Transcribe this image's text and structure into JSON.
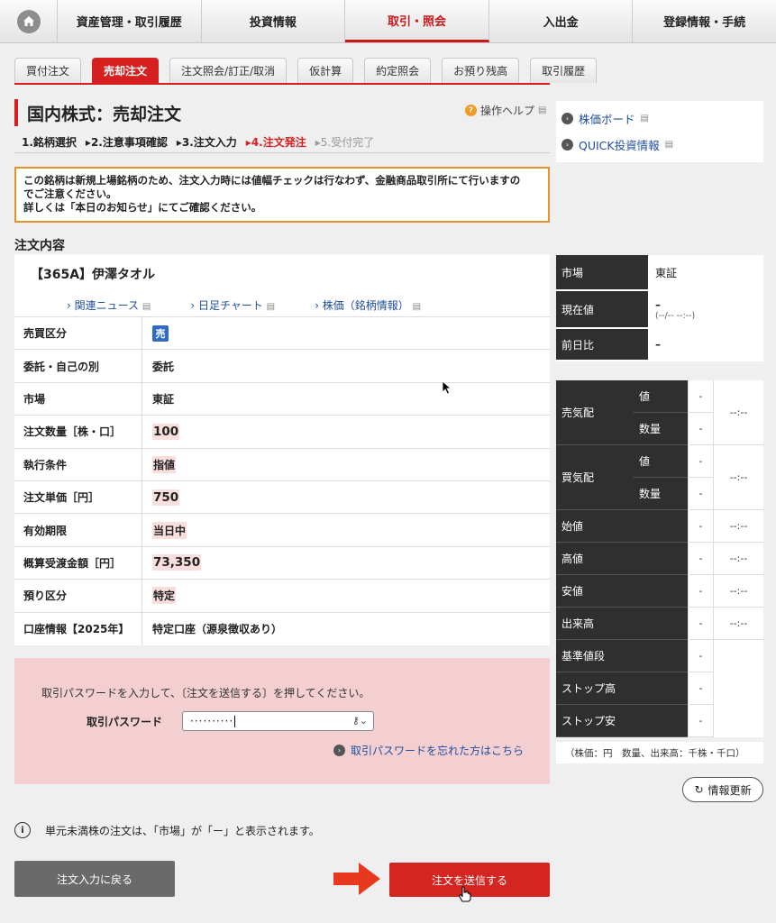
{
  "nav": {
    "items": [
      "資産管理・取引履歴",
      "投資情報",
      "取引・照会",
      "入出金",
      "登録情報・手続"
    ],
    "active_index": 2
  },
  "subtabs": {
    "items": [
      "買付注文",
      "売却注文",
      "注文照会/訂正/取消",
      "仮計算",
      "約定照会",
      "お預り残高",
      "取引履歴"
    ],
    "active_index": 1
  },
  "page": {
    "title": "国内株式：売却注文",
    "help": "操作ヘルプ"
  },
  "steps": [
    "1.銘柄選択",
    "▸2.注意事項確認",
    "▸3.注文入力",
    "▸4.注文発注",
    "▸5.受付完了"
  ],
  "notice": {
    "line1": "この銘柄は新規上場銘柄のため、注文入力時には値幅チェックは行なわず、金融商品取引所にて行いますの",
    "line2": "でご注意ください。",
    "line3": "詳しくは「本日のお知らせ」にてご確認ください。"
  },
  "side_links": [
    "株価ボード",
    "QUICK投資情報"
  ],
  "order": {
    "heading": "注文内容",
    "stock_name": "【365A】伊澤タオル",
    "links": [
      "関連ニュース",
      "日足チャート",
      "株価（銘柄情報）"
    ],
    "rows": [
      {
        "key": "売買区分",
        "value": "売"
      },
      {
        "key": "委託・自己の別",
        "value": "委託"
      },
      {
        "key": "市場",
        "value": "東証"
      },
      {
        "key": "注文数量［株・口］",
        "value": "100"
      },
      {
        "key": "執行条件",
        "value": "指値"
      },
      {
        "key": "注文単価［円］",
        "value": "750"
      },
      {
        "key": "有効期限",
        "value": "当日中"
      },
      {
        "key": "概算受渡金額［円］",
        "value": "73,350"
      },
      {
        "key": "預り区分",
        "value": "特定"
      },
      {
        "key": "口座情報【2025年】",
        "value": "特定口座（源泉徴収あり）"
      }
    ]
  },
  "password": {
    "instruction": "取引パスワードを入力して、〔注文を送信する〕を押してください。",
    "label": "取引パスワード",
    "value": "··········",
    "forgot": "取引パスワードを忘れた方はこちら"
  },
  "quote": {
    "market_label": "市場",
    "market": "東証",
    "current_label": "現在値",
    "current": "–",
    "current_time": "(--/-- --:--)",
    "change_label": "前日比",
    "change": "–",
    "ask_label": "売気配",
    "bid_label": "買気配",
    "price_label": "値",
    "qty_label": "数量",
    "dash": "-",
    "time_dash": "--:--",
    "rows": [
      "始値",
      "高値",
      "安値",
      "出来高"
    ],
    "rows2": [
      "基準値段",
      "ストップ高",
      "ストップ安"
    ],
    "note": "（株価：円　数量、出来高：千株・千口）",
    "refresh": "情報更新"
  },
  "footer": {
    "info": "単元未満株の注文は、「市場」が「ー」と表示されます。",
    "back": "注文入力に戻る",
    "send": "注文を送信する"
  }
}
